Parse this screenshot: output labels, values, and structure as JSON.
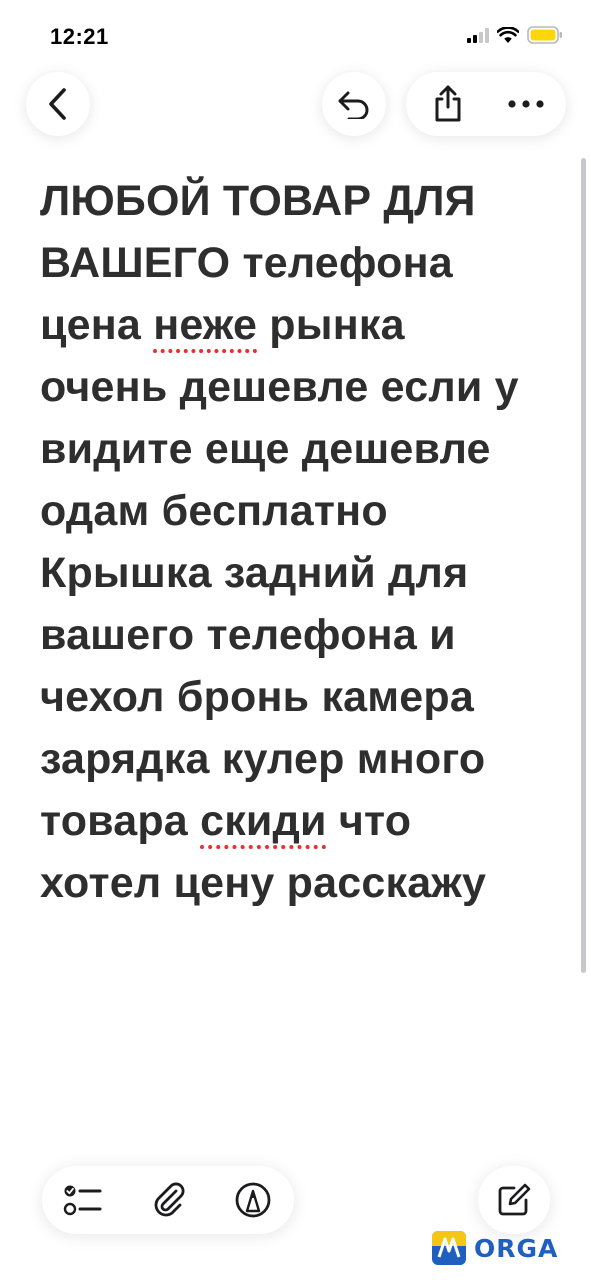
{
  "status_bar": {
    "time": "12:21"
  },
  "toolbar_top": {
    "back_icon": "chevron-left-icon",
    "undo_icon": "undo-icon",
    "share_icon": "share-icon",
    "more_icon": "ellipsis-icon"
  },
  "note": {
    "lines": [
      {
        "text": "ЛЮБОЙ ТОВАР ДЛЯ"
      },
      {
        "text": "ВАШЕГО телефона"
      },
      {
        "before": "цена ",
        "misspelled": "неже",
        "after": " рынка"
      },
      {
        "text": "очень дешевле если у"
      },
      {
        "text": "видите еще дешевле"
      },
      {
        "text": "одам бесплатно"
      },
      {
        "text": "Крышка задний для"
      },
      {
        "text": "вашего телефона и"
      },
      {
        "text": "чехол бронь камера"
      },
      {
        "text": "зарядка кулер много"
      },
      {
        "before": "товара ",
        "misspelled": "скиди",
        "after": " что"
      },
      {
        "text": "хотел цену расскажу"
      }
    ]
  },
  "toolbar_bottom": {
    "checklist_icon": "checklist-icon",
    "attach_icon": "paperclip-icon",
    "markup_icon": "pen-markup-icon",
    "compose_icon": "compose-icon"
  },
  "watermark": {
    "text": "ORGA"
  },
  "colors": {
    "text": "#2e2e2e",
    "misspell_underline": "#e0342c",
    "watermark": "#1f5fbf",
    "battery": "#ffd60a"
  }
}
